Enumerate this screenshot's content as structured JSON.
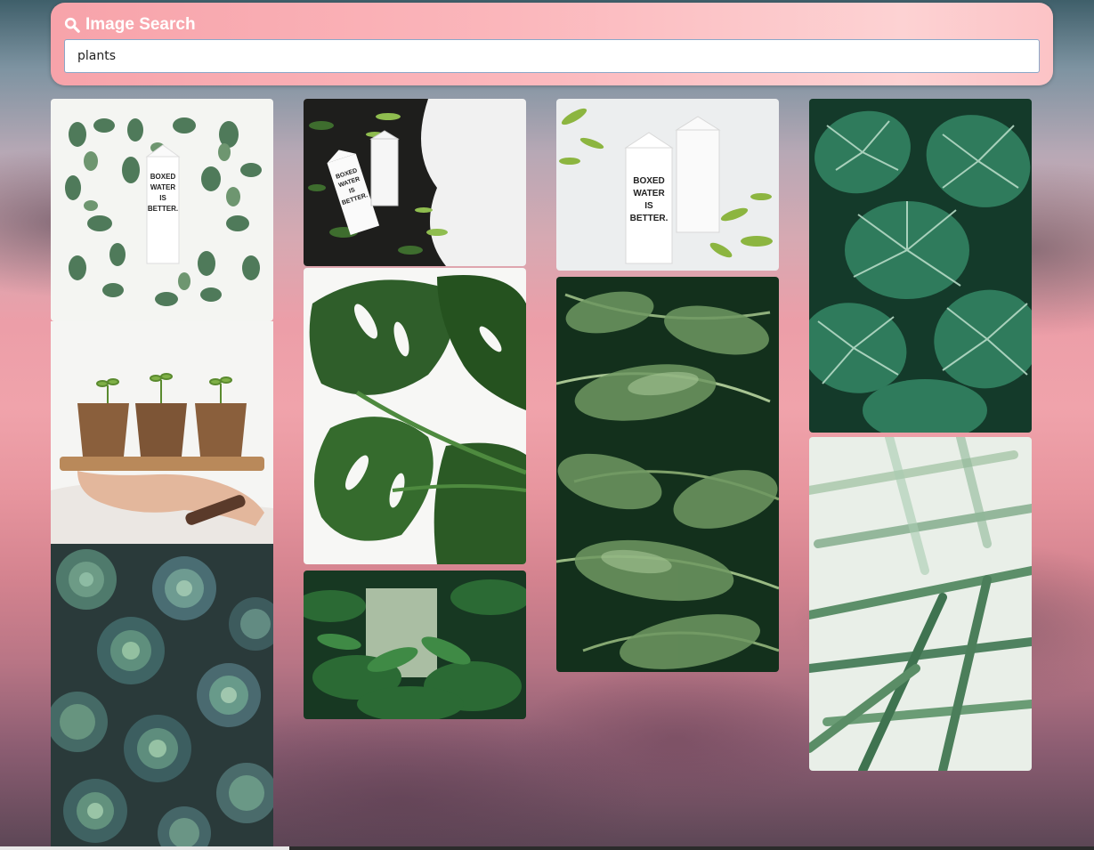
{
  "header": {
    "title": "Image Search",
    "icon": "search-icon"
  },
  "search": {
    "value": "plants",
    "placeholder": ""
  },
  "theme": {
    "accent": "#f7a3aa",
    "input_border": "#8aa7c8"
  },
  "results": {
    "columns": [
      [
        "eucalyptus-flatlay-carton",
        "seedlings-in-pots",
        "succulents"
      ],
      [
        "cartons-on-soil",
        "monstera-leaves",
        "jungle-foliage"
      ],
      [
        "cartons-with-ferns",
        "palm-fronds"
      ],
      [
        "calathea-leaves",
        "palm-closeup"
      ]
    ],
    "carton_text": "BOXED WATER IS BETTER."
  }
}
